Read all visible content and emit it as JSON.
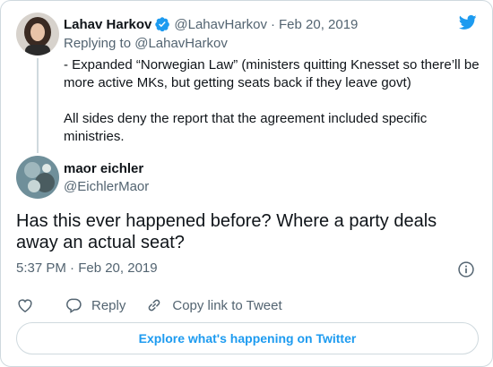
{
  "tweet1": {
    "author_name": "Lahav Harkov",
    "handle": "@LahavHarkov",
    "separator": "·",
    "date": "Feb 20, 2019",
    "replying_to": "Replying to @LahavHarkov",
    "paragraphs": [
      "- Expanded “Norwegian Law” (ministers quitting Knesset so there’ll be more active MKs, but getting seats back if they leave govt)",
      "All sides deny the report that the agreement included specific ministries."
    ]
  },
  "tweet2": {
    "author_name": "maor eichler",
    "handle": "@EichlerMaor",
    "text": "Has this ever happened before? Where a party deals away an actual seat?",
    "timestamp": "5:37 PM · Feb 20, 2019"
  },
  "actions": {
    "reply_label": "Reply",
    "copy_label": "Copy link to Tweet"
  },
  "explore_label": "Explore what's happening on Twitter",
  "colors": {
    "accent": "#1d9bf0",
    "text": "#0f1419",
    "secondary": "#536471",
    "border": "#cfd9de"
  },
  "icons": [
    "twitter-logo-icon",
    "verified-badge-icon",
    "info-icon",
    "heart-icon",
    "reply-icon",
    "link-icon"
  ]
}
